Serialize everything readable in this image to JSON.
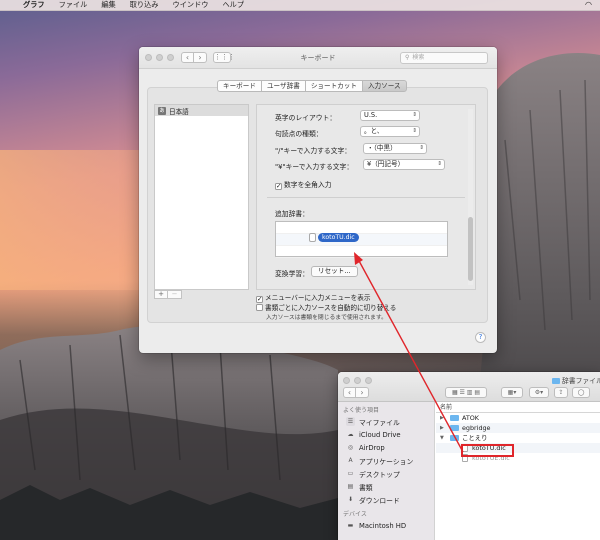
{
  "menubar": {
    "app": "グラフ",
    "items": [
      "ファイル",
      "編集",
      "取り込み",
      "ウインドウ",
      "ヘルプ"
    ]
  },
  "prefs": {
    "title": "キーボード",
    "search_placeholder": "検索",
    "tabs": [
      "キーボード",
      "ユーザ辞書",
      "ショートカット",
      "入力ソース"
    ],
    "active_tab": "入力ソース",
    "source_list": [
      "日本語"
    ],
    "settings": {
      "layout_label": "英字のレイアウト：",
      "layout_value": "U.S.",
      "punct_label": "句読点の種類：",
      "punct_value": "。と、",
      "slash_label": "\"/\"キーで入力する文字：",
      "slash_value": "・（中黒）",
      "yen_label": "\"¥\"キーで入力する文字：",
      "yen_value": "¥（円記号）",
      "fullwidth_digits": "数字を全角入力",
      "dict_label": "追加辞書：",
      "drag_file": "kotoTU.dic",
      "learning_label": "変換学習：",
      "reset_button": "リセット..."
    },
    "options": {
      "show_menu": "メニューバーに入力メニューを表示",
      "auto_switch": "書類ごとに入力ソースを自動的に切り替える",
      "note": "入力ソースは書類を閉じるまで使用されます。"
    },
    "plus": "+",
    "minus": "−",
    "help": "?"
  },
  "finder": {
    "title": "辞書ファイル",
    "sidebar_fav_header": "よく使う項目",
    "sidebar_items": [
      {
        "label": "マイファイル",
        "icon": "all-files-icon"
      },
      {
        "label": "iCloud Drive",
        "icon": "cloud-icon"
      },
      {
        "label": "AirDrop",
        "icon": "airdrop-icon"
      },
      {
        "label": "アプリケーション",
        "icon": "apps-icon"
      },
      {
        "label": "デスクトップ",
        "icon": "desktop-icon"
      },
      {
        "label": "書類",
        "icon": "documents-icon"
      },
      {
        "label": "ダウンロード",
        "icon": "downloads-icon"
      }
    ],
    "sidebar_dev_header": "デバイス",
    "device_item": "Macintosh HD",
    "col_name": "名前",
    "rows": [
      {
        "name": "ATOK",
        "type": "folder"
      },
      {
        "name": "egbridge",
        "type": "folder"
      },
      {
        "name": "ことえり",
        "type": "folder",
        "open": true
      },
      {
        "name": "kotoTU.dic",
        "type": "file"
      },
      {
        "name": "kotoTUE.dic",
        "type": "file"
      }
    ]
  },
  "colors": {
    "highlight": "#e0262b",
    "selection": "#2e67c8"
  }
}
